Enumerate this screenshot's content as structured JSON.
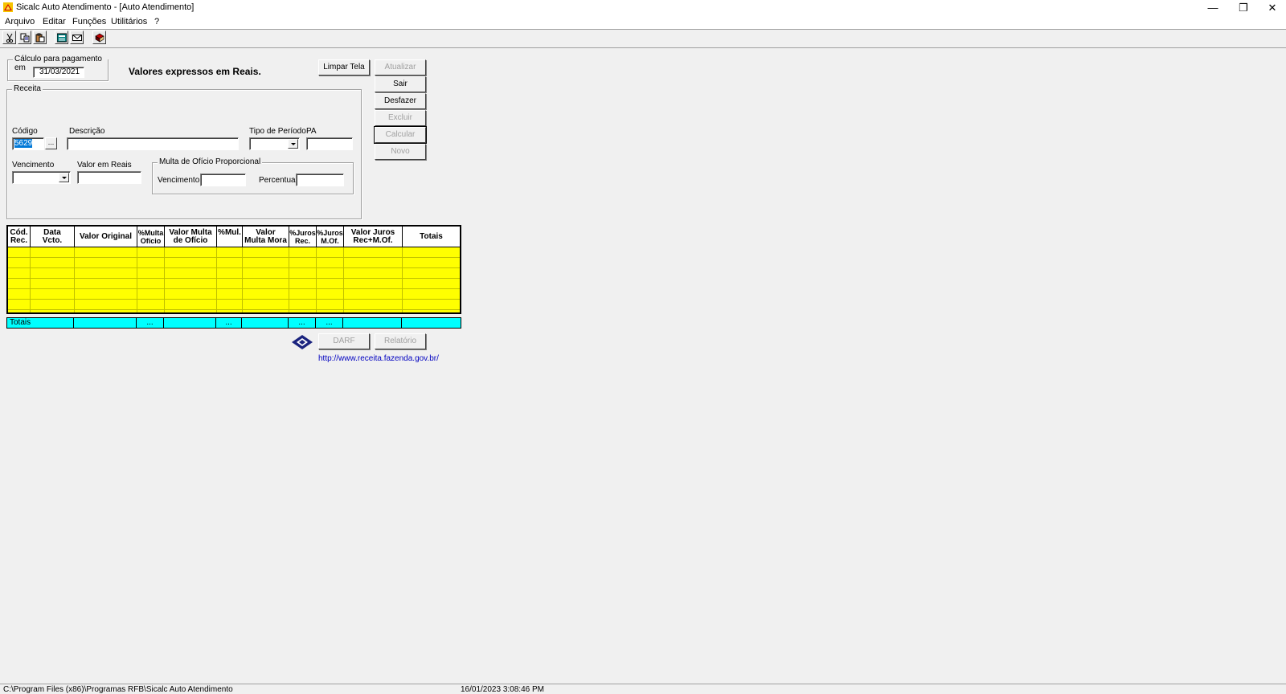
{
  "window": {
    "title": "Sicalc Auto Atendimento - [Auto Atendimento]",
    "controls": {
      "minimize": "—",
      "restore": "❐",
      "close": "✕"
    }
  },
  "menu": {
    "items": [
      "Arquivo",
      "Editar",
      "Funções",
      "Utilitários",
      "?"
    ]
  },
  "toolbar": {
    "icons": [
      "cut-icon",
      "copy-icon",
      "paste-icon",
      "calculator-icon",
      "envelope-icon",
      "book-icon"
    ]
  },
  "calc": {
    "group_label": "Cálculo para pagamento em",
    "date": "31/03/2021",
    "valores_text": "Valores expressos em Reais."
  },
  "buttons": {
    "limpar": "Limpar Tela",
    "atualizar": "Atualizar",
    "sair": "Sair",
    "desfazer": "Desfazer",
    "excluir": "Excluir",
    "calcular": "Calcular",
    "novo": "Novo",
    "dare": "DARF",
    "relatorio": "Relatório",
    "browse": "..."
  },
  "receita": {
    "group_label": "Receita",
    "codigo_label": "Código",
    "codigo_value": "5629",
    "descricao_label": "Descrição",
    "descricao_value": "",
    "tipo_periodo_label": "Tipo de Período",
    "pa_label": "PA",
    "vencimento_label": "Vencimento",
    "valor_reais_label": "Valor em Reais",
    "multa_group_label": "Multa de Ofício Proporcional",
    "multa_vencimento_label": "Vencimento:",
    "multa_percentual_label": "Percentual:"
  },
  "grid": {
    "headers": [
      [
        "Cód.",
        "Rec."
      ],
      [
        "Data",
        "Vcto."
      ],
      [
        "Valor Original"
      ],
      [
        "%Multa",
        "Ofício"
      ],
      [
        "Valor Multa",
        "de Ofício"
      ],
      [
        "%Mul."
      ],
      [
        "Valor",
        "Multa Mora"
      ],
      [
        "%Juros",
        "Rec."
      ],
      [
        "%Juros",
        "M.Of."
      ],
      [
        "Valor Juros",
        "Rec+M.Of."
      ],
      [
        "Totais"
      ]
    ],
    "totals_label": "Totais",
    "totals_cells": [
      "",
      "",
      "...",
      "",
      "...",
      "",
      "...",
      "...",
      "",
      ""
    ]
  },
  "link": {
    "url": "http://www.receita.fazenda.gov.br/"
  },
  "status": {
    "path": "C:\\Program Files (x86)\\Programas RFB\\Sicalc Auto Atendimento",
    "datetime": "16/01/2023  3:08:46 PM"
  },
  "colors": {
    "grid_bg": "#ffff00",
    "totals_bg": "#00ffff",
    "link": "#0000c0",
    "disabled": "#a0a0a0"
  }
}
